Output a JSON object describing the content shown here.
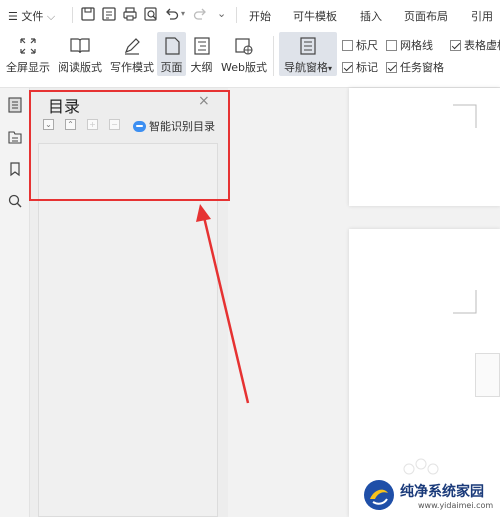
{
  "menubar": {
    "file_label": "文件",
    "tabs": [
      "开始",
      "可牛模板",
      "插入",
      "页面布局",
      "引用"
    ]
  },
  "ribbon": {
    "buttons": [
      {
        "label": "全屏显示",
        "icon": "fullscreen-icon"
      },
      {
        "label": "阅读版式",
        "icon": "book-icon"
      },
      {
        "label": "写作模式",
        "icon": "pen-icon"
      },
      {
        "label": "页面",
        "icon": "page-icon"
      },
      {
        "label": "大纲",
        "icon": "outline-icon"
      },
      {
        "label": "Web版式",
        "icon": "web-icon"
      }
    ],
    "nav_pane_label": "导航窗格",
    "checkboxes": [
      {
        "label": "标尺",
        "checked": false
      },
      {
        "label": "网格线",
        "checked": false
      },
      {
        "label": "表格虚框",
        "checked": true
      },
      {
        "label": "标记",
        "checked": true
      },
      {
        "label": "任务窗格",
        "checked": true
      }
    ]
  },
  "toc_panel": {
    "title": "目录",
    "close_glyph": "×",
    "smart_toc_label": "智能识别目录"
  },
  "watermark": {
    "title": "纯净系统家园",
    "url": "www.yidaimei.com"
  },
  "colors": {
    "highlight": "#e63232",
    "accent": "#3c8ff2",
    "active_button_bg": "#dfe3ea"
  }
}
